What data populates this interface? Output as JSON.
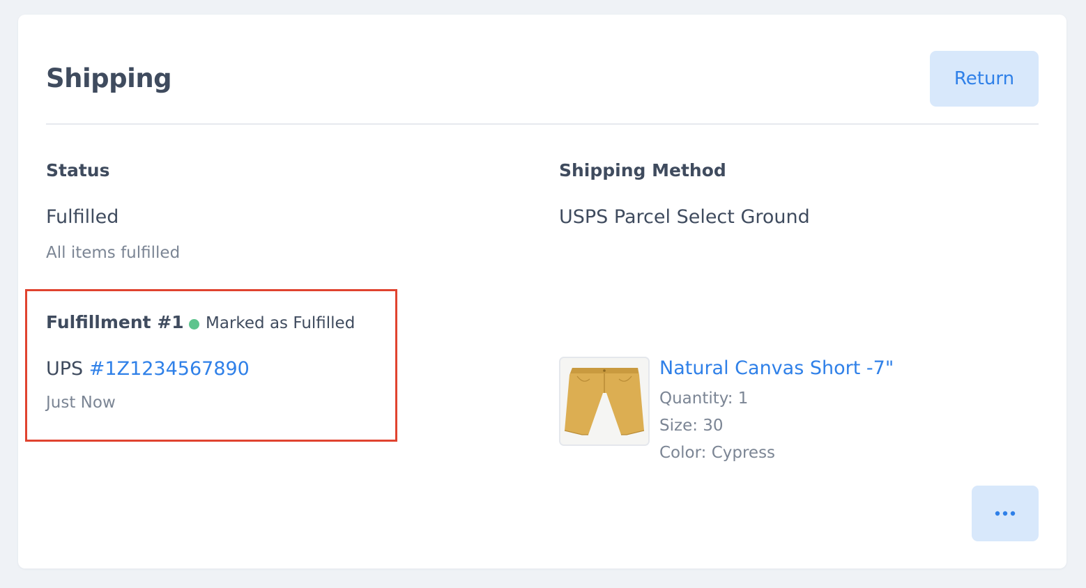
{
  "section": {
    "title": "Shipping",
    "return_label": "Return"
  },
  "status": {
    "heading": "Status",
    "value": "Fulfilled",
    "subtext": "All items fulfilled"
  },
  "shipping_method": {
    "heading": "Shipping Method",
    "value": "USPS Parcel Select Ground"
  },
  "fulfillment": {
    "title": "Fulfillment #1",
    "status_label": "Marked as Fulfilled",
    "status_color": "#5ec48d",
    "carrier": "UPS",
    "tracking_number": "#1Z1234567890",
    "time": "Just Now"
  },
  "product": {
    "name": "Natural Canvas Short -7\"",
    "quantity": "Quantity: 1",
    "size": "Size: 30",
    "color": "Color: Cypress",
    "image_icon": "shorts-image"
  },
  "more_button": {
    "icon": "ellipsis-icon"
  },
  "colors": {
    "accent": "#2f80e8",
    "button_bg": "#d8e8fb",
    "highlight_border": "#e0432f"
  }
}
